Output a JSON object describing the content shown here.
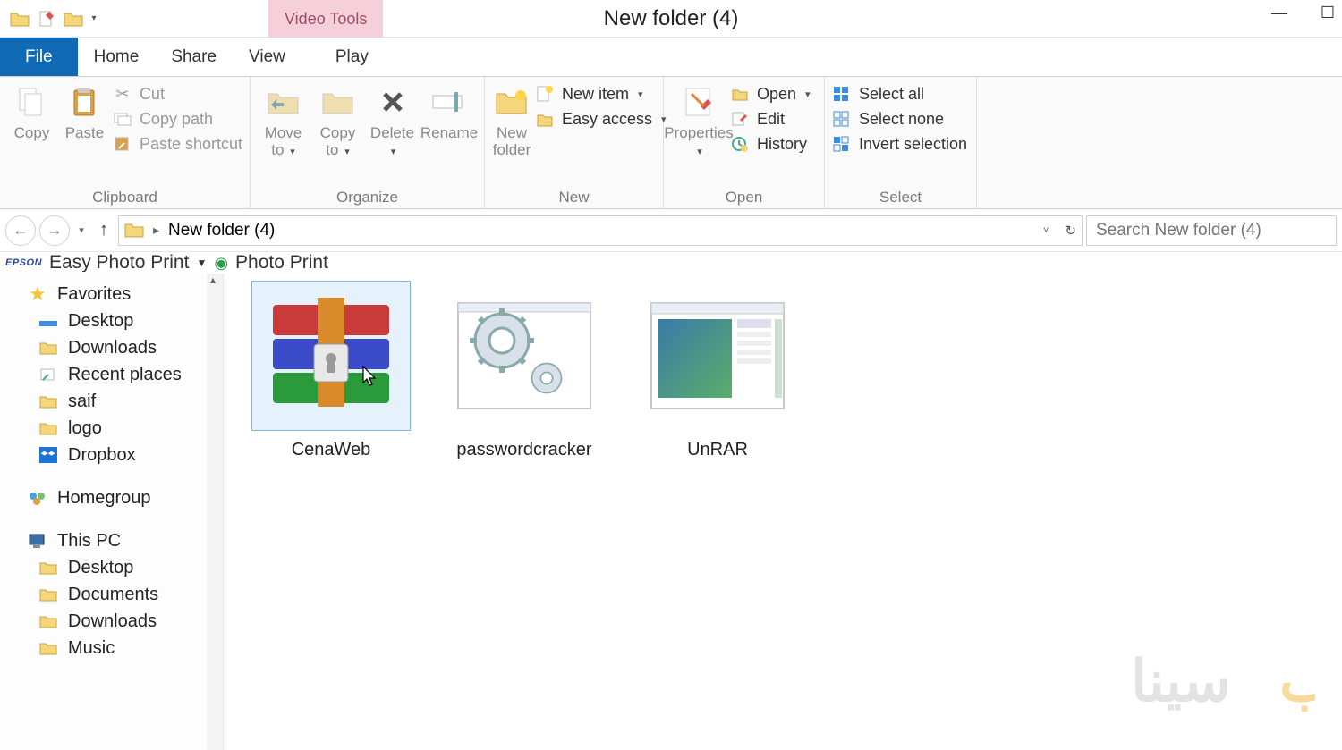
{
  "title": "New folder (4)",
  "contextual_tab": "Video Tools",
  "tabs": {
    "file": "File",
    "home": "Home",
    "share": "Share",
    "view": "View",
    "play": "Play"
  },
  "ribbon": {
    "clipboard": {
      "label": "Clipboard",
      "copy": "Copy",
      "paste": "Paste",
      "cut": "Cut",
      "copy_path": "Copy path",
      "paste_shortcut": "Paste shortcut"
    },
    "organize": {
      "label": "Organize",
      "move_to": "Move to",
      "copy_to": "Copy to",
      "delete": "Delete",
      "rename": "Rename"
    },
    "new": {
      "label": "New",
      "new_folder": "New folder",
      "new_item": "New item",
      "easy_access": "Easy access"
    },
    "open": {
      "label": "Open",
      "properties": "Properties",
      "open": "Open",
      "edit": "Edit",
      "history": "History"
    },
    "select": {
      "label": "Select",
      "select_all": "Select all",
      "select_none": "Select none",
      "invert": "Invert selection"
    }
  },
  "breadcrumb": {
    "current": "New folder (4)"
  },
  "search": {
    "placeholder": "Search New folder (4)"
  },
  "epson": {
    "app": "Easy Photo Print",
    "action": "Photo Print"
  },
  "sidebar": {
    "favorites": "Favorites",
    "fav_items": [
      "Desktop",
      "Downloads",
      "Recent places",
      "saif",
      "logo",
      "Dropbox"
    ],
    "homegroup": "Homegroup",
    "this_pc": "This PC",
    "pc_items": [
      "Desktop",
      "Documents",
      "Downloads",
      "Music"
    ]
  },
  "files": [
    {
      "name": "CenaWeb",
      "type": "rar",
      "selected": true
    },
    {
      "name": "passwordcracker",
      "type": "exe-gear",
      "selected": false
    },
    {
      "name": "UnRAR",
      "type": "exe-window",
      "selected": false
    }
  ]
}
